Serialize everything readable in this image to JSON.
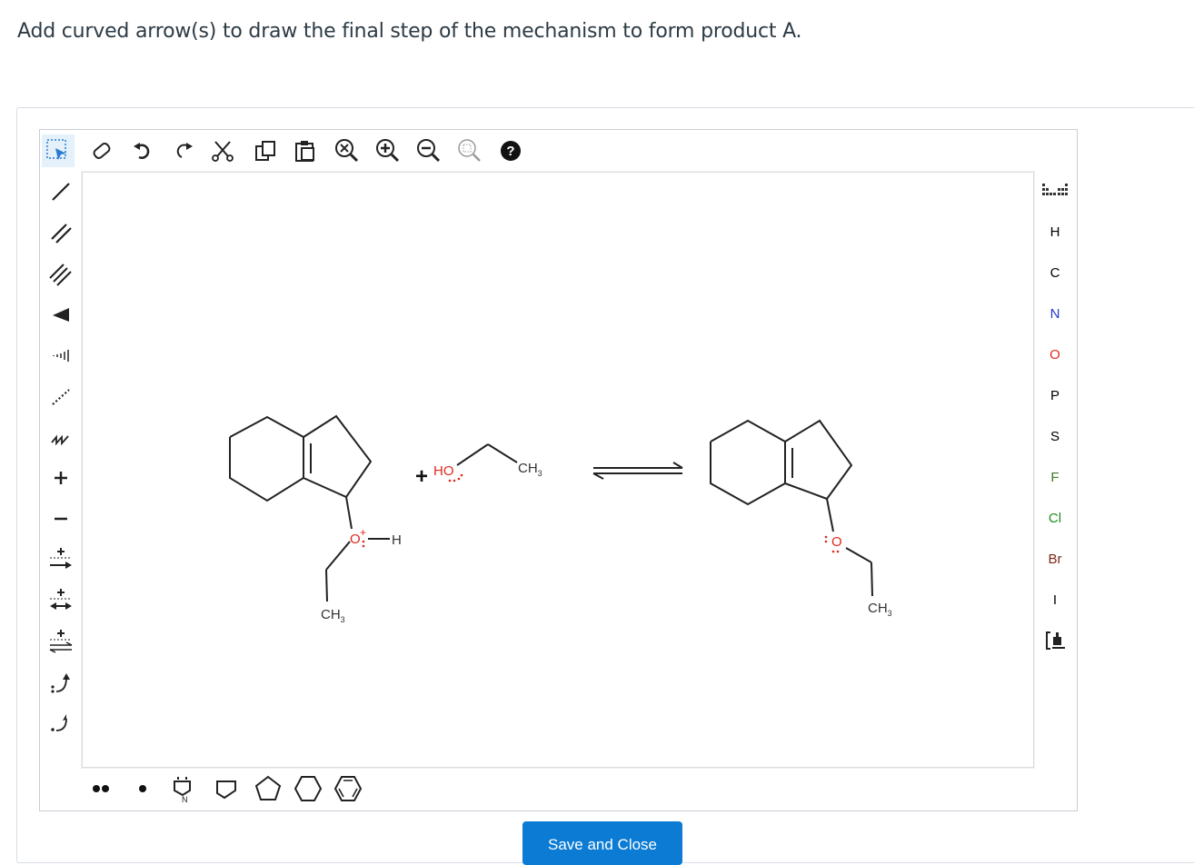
{
  "question": "Add curved arrow(s) to draw the final step of the mechanism to form product A.",
  "top_toolbar": [
    {
      "name": "select-tool-icon",
      "selected": true
    },
    {
      "name": "eraser-icon"
    },
    {
      "name": "undo-icon"
    },
    {
      "name": "redo-icon"
    },
    {
      "name": "cut-icon"
    },
    {
      "name": "copy-icon"
    },
    {
      "name": "paste-icon"
    },
    {
      "name": "zoom-clear-icon"
    },
    {
      "name": "zoom-in-icon"
    },
    {
      "name": "zoom-out-icon"
    },
    {
      "name": "zoom-fit-icon"
    },
    {
      "name": "help-icon"
    }
  ],
  "left_toolbar": [
    "single-bond-icon",
    "double-bond-icon",
    "triple-bond-icon",
    "wedge-bond-icon",
    "hashed-wedge-bond-icon",
    "dashed-bond-icon",
    "chain-icon",
    "positive-charge-icon",
    "negative-charge-icon",
    "reaction-arrow-icon",
    "resonance-arrow-icon",
    "equilibrium-arrow-icon",
    "electron-pair-arrow-icon",
    "single-electron-arrow-icon"
  ],
  "right_toolbar": {
    "periodic_table_icon": "periodic-table-icon",
    "elements": [
      {
        "symbol": "H",
        "color": "#444444"
      },
      {
        "symbol": "C",
        "color": "#222222"
      },
      {
        "symbol": "N",
        "color": "#1f3ccf"
      },
      {
        "symbol": "O",
        "color": "#e0281e"
      },
      {
        "symbol": "P",
        "color": "#444444"
      },
      {
        "symbol": "S",
        "color": "#444444"
      },
      {
        "symbol": "F",
        "color": "#3b7d23"
      },
      {
        "symbol": "Cl",
        "color": "#1f8a1f"
      },
      {
        "symbol": "Br",
        "color": "#7a2a1a"
      },
      {
        "symbol": "I",
        "color": "#444444"
      }
    ],
    "template_icon": "bracket-template-icon"
  },
  "bottom_toolbar": [
    "lone-pair-icon",
    "radical-icon",
    "nitrogen-ring-icon",
    "cyclobutane-icon",
    "cyclopentane-icon",
    "cyclohexane-icon",
    "benzene-icon"
  ],
  "molecule": {
    "reactant_oxonium_label": "O",
    "reactant_oxonium_charge": "+",
    "reactant_h_label": "H",
    "reactant_ch3_label": "CH",
    "reactant_ch3_sub": "3",
    "ethanol_ho_label": "HO",
    "ethanol_ch3_label": "CH",
    "ethanol_ch3_sub": "3",
    "plus_sign": "+",
    "product_o_label": "O",
    "product_ch3_label": "CH",
    "product_ch3_sub": "3"
  },
  "colors": {
    "accent": "#0b7bd4",
    "oxygen": "#e0281e",
    "bond": "#222222"
  },
  "save_button": "Save and Close"
}
